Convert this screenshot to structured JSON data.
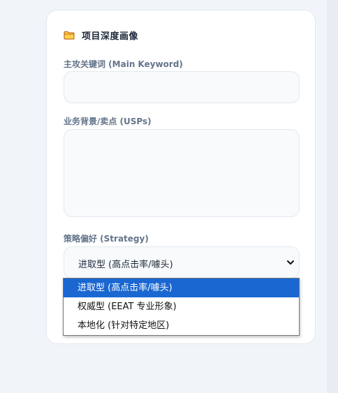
{
  "card": {
    "icon": "folder-icon",
    "title": "项目深度画像"
  },
  "fields": {
    "keyword_label": "主攻关键词 (Main Keyword)",
    "keyword_value": "",
    "usps_label": "业务背景/卖点 (USPs)",
    "usps_value": "",
    "strategy_label": "策略偏好 (Strategy)"
  },
  "strategy_select": {
    "selected": "进取型 (高点击率/噱头)",
    "options": [
      "进取型 (高点击率/噱头)",
      "权威型 (EEAT 专业形象)",
      "本地化 (针对特定地区)"
    ],
    "highlighted_index": 0
  },
  "colors": {
    "folder_fill": "#fcd34d",
    "folder_stroke": "#b45309",
    "highlight": "#1a67d2",
    "label": "#64748b",
    "title": "#1e293b"
  }
}
